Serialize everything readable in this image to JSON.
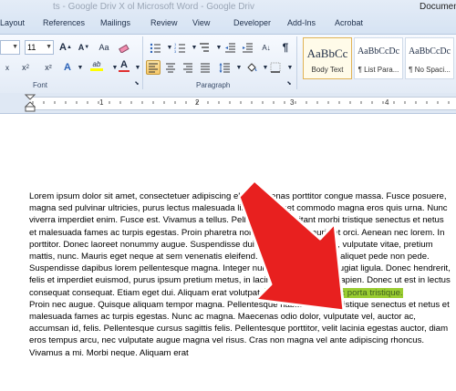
{
  "window": {
    "title_ghost": "ts - Google Driv  X  ol Microsoft Word - Google Driv",
    "title_app": "Documen"
  },
  "tabs": [
    {
      "label": "Layout"
    },
    {
      "label": "References"
    },
    {
      "label": "Mailings"
    },
    {
      "label": "Review"
    },
    {
      "label": "View"
    },
    {
      "label": "Developer"
    },
    {
      "label": "Add-Ins"
    },
    {
      "label": "Acrobat"
    }
  ],
  "font_group": {
    "label": "Font",
    "font_name_value": "",
    "font_size_value": "11",
    "grow_label": "A",
    "shrink_label": "A",
    "clear_label": "Aa",
    "superscript_label": "x²",
    "highlight_label": "ab",
    "color_label": "A",
    "highlight_color": "#ffff00",
    "font_color": "#e03030"
  },
  "paragraph_group": {
    "label": "Paragraph",
    "show_marks_label": "¶"
  },
  "styles": [
    {
      "sample": "AaBbCc",
      "name": "Body Text"
    },
    {
      "sample": "AaBbCcDc",
      "name": "¶ List Para..."
    },
    {
      "sample": "AaBbCcDc",
      "name": "¶ No Spaci..."
    }
  ],
  "ruler": {
    "numbers": [
      "1",
      "2",
      "3",
      "4"
    ]
  },
  "document": {
    "paragraph_1_main": "Lorem ipsum dolor sit amet, consectetuer adipiscing elit. Maecenas porttitor congue massa. Fusce posuere, magna sed pulvinar ultricies, purus lectus malesuada libero, sit amet commodo magna eros quis urna. Nunc viverra imperdiet enim. Fusce est. Vivamus a tellus. Pellentesque habitant morbi tristique senectus et netus et malesuada fames ac turpis egestas. Proin pharetra nonummy pede. Mauris et orci. Aenean nec lorem. In porttitor. Donec laoreet nonummy augue. Suspendisse dui purus, scelerisque at, vulputate vitae, pretium mattis, nunc. Mauris eget neque at sem venenatis eleifend. Ut nonummy. Fusce aliquet pede non pede. Suspendisse dapibus lorem pellentesque magna. Integer nulla. Donec blandit feugiat ligula. Donec hendrerit, felis et imperdiet euismod, purus ipsum pretium metus, in lacinia nulla nisl eget sapien. Donec ut est in lectus consequat consequat. Etiam eget dui. Aliquam erat volutpat. ",
    "paragraph_1_highlight": "Sed at lorem in nunc porta tristique.",
    "paragraph_2": "Proin nec augue. Quisque aliquam tempor magna. Pellentesque habitant morbi tristique senectus et netus et malesuada fames ac turpis egestas. Nunc ac magna. Maecenas odio dolor, vulputate vel, auctor ac, accumsan id, felis. Pellentesque cursus sagittis felis. Pellentesque porttitor, velit lacinia egestas auctor, diam eros tempus arcu, nec vulputate augue magna vel risus. Cras non magna vel ante adipiscing rhoncus. Vivamus a mi. Morbi neque. Aliquam erat"
  },
  "annotation": {
    "arrow_color": "#e8201f",
    "arrow_outline": "#ffffff"
  }
}
